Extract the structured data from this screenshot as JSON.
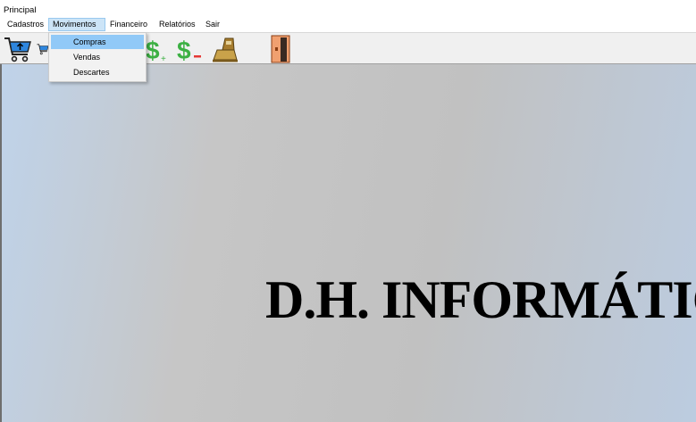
{
  "window": {
    "title": "Principal"
  },
  "menu": {
    "items": [
      {
        "label": "Cadastros"
      },
      {
        "label": "Movimentos"
      },
      {
        "label": "Financeiro"
      },
      {
        "label": "Relatórios"
      },
      {
        "label": "Sair"
      }
    ],
    "open_menu": "Movimentos",
    "dropdown": [
      {
        "label": "Compras",
        "highlighted": true
      },
      {
        "label": "Vendas"
      },
      {
        "label": "Descartes"
      }
    ]
  },
  "toolbar": {
    "buttons": [
      {
        "icon": "shopping-cart-up-icon"
      },
      {
        "icon": "shopping-cart-icon"
      },
      {
        "icon": "dollar-plus-icon",
        "text": "$",
        "suffix": "+",
        "color": "#3cb043"
      },
      {
        "icon": "dollar-minus-icon",
        "text": "$",
        "suffix": "-",
        "color": "#3cb043",
        "suffix_color": "#e53935"
      },
      {
        "icon": "cash-register-icon"
      },
      {
        "icon": "exit-door-icon"
      }
    ]
  },
  "main": {
    "banner": "D.H. INFORMÁTICA"
  },
  "colors": {
    "menu_open": "#cce4f7",
    "dropdown_highlight": "#91c9f7",
    "toolbar": "#f0f0f0",
    "cart": "#2e86de"
  }
}
